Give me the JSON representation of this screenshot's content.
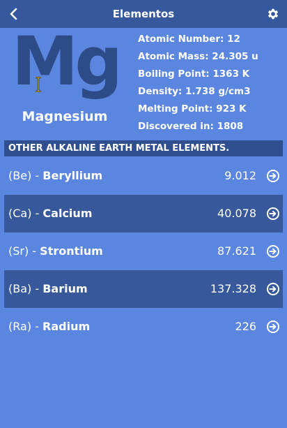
{
  "header": {
    "title": "Elementos",
    "back_icon": "back-arrow-icon",
    "settings_icon": "gear-icon"
  },
  "element": {
    "symbol": "Mg",
    "name": "Magnesium",
    "properties": [
      {
        "label": "Atomic Number:",
        "value": "12"
      },
      {
        "label": "Atomic Mass:",
        "value": "24.305 u"
      },
      {
        "label": "Boiling Point:",
        "value": "1363 K"
      },
      {
        "label": "Density:",
        "value": "1.738 g/cm3"
      },
      {
        "label": "Melting Point:",
        "value": "923 K"
      },
      {
        "label": "Discovered in:",
        "value": "1808"
      }
    ]
  },
  "section": {
    "title": "OTHER ALKALINE EARTH METAL ELEMENTS."
  },
  "related": [
    {
      "symbol": "(Be)",
      "name": "Beryllium",
      "mass": "9.012"
    },
    {
      "symbol": "(Ca)",
      "name": "Calcium",
      "mass": "40.078"
    },
    {
      "symbol": "(Sr)",
      "name": "Strontium",
      "mass": "87.621"
    },
    {
      "symbol": "(Ba)",
      "name": "Barium",
      "mass": "137.328"
    },
    {
      "symbol": "(Ra)",
      "name": "Radium",
      "mass": "226"
    }
  ],
  "colors": {
    "background": "#5b86df",
    "bar": "#36589d",
    "symbol": "#2d4b87",
    "alt_row": "#37599b"
  }
}
